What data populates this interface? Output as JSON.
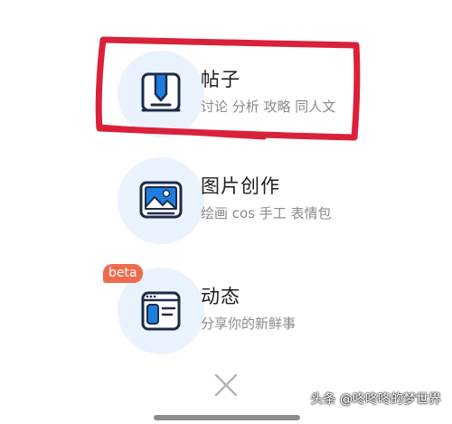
{
  "items": [
    {
      "title": "帖子",
      "subtitle": "讨论 分析 攻略 同人文",
      "icon": "post-pencil-icon"
    },
    {
      "title": "图片创作",
      "subtitle": "绘画 cos 手工 表情包",
      "icon": "picture-icon"
    },
    {
      "title": "动态",
      "subtitle": "分享你的新鲜事",
      "icon": "feed-window-icon",
      "badge": "beta"
    }
  ],
  "close_icon": "close-icon",
  "watermark": "头条 @咚咚咚的梦世界",
  "colors": {
    "icon_bg": "#eaf3fd",
    "icon_blue": "#1e7ee0",
    "highlight_red": "#d9213a",
    "beta_badge": "#ef6b4d"
  }
}
